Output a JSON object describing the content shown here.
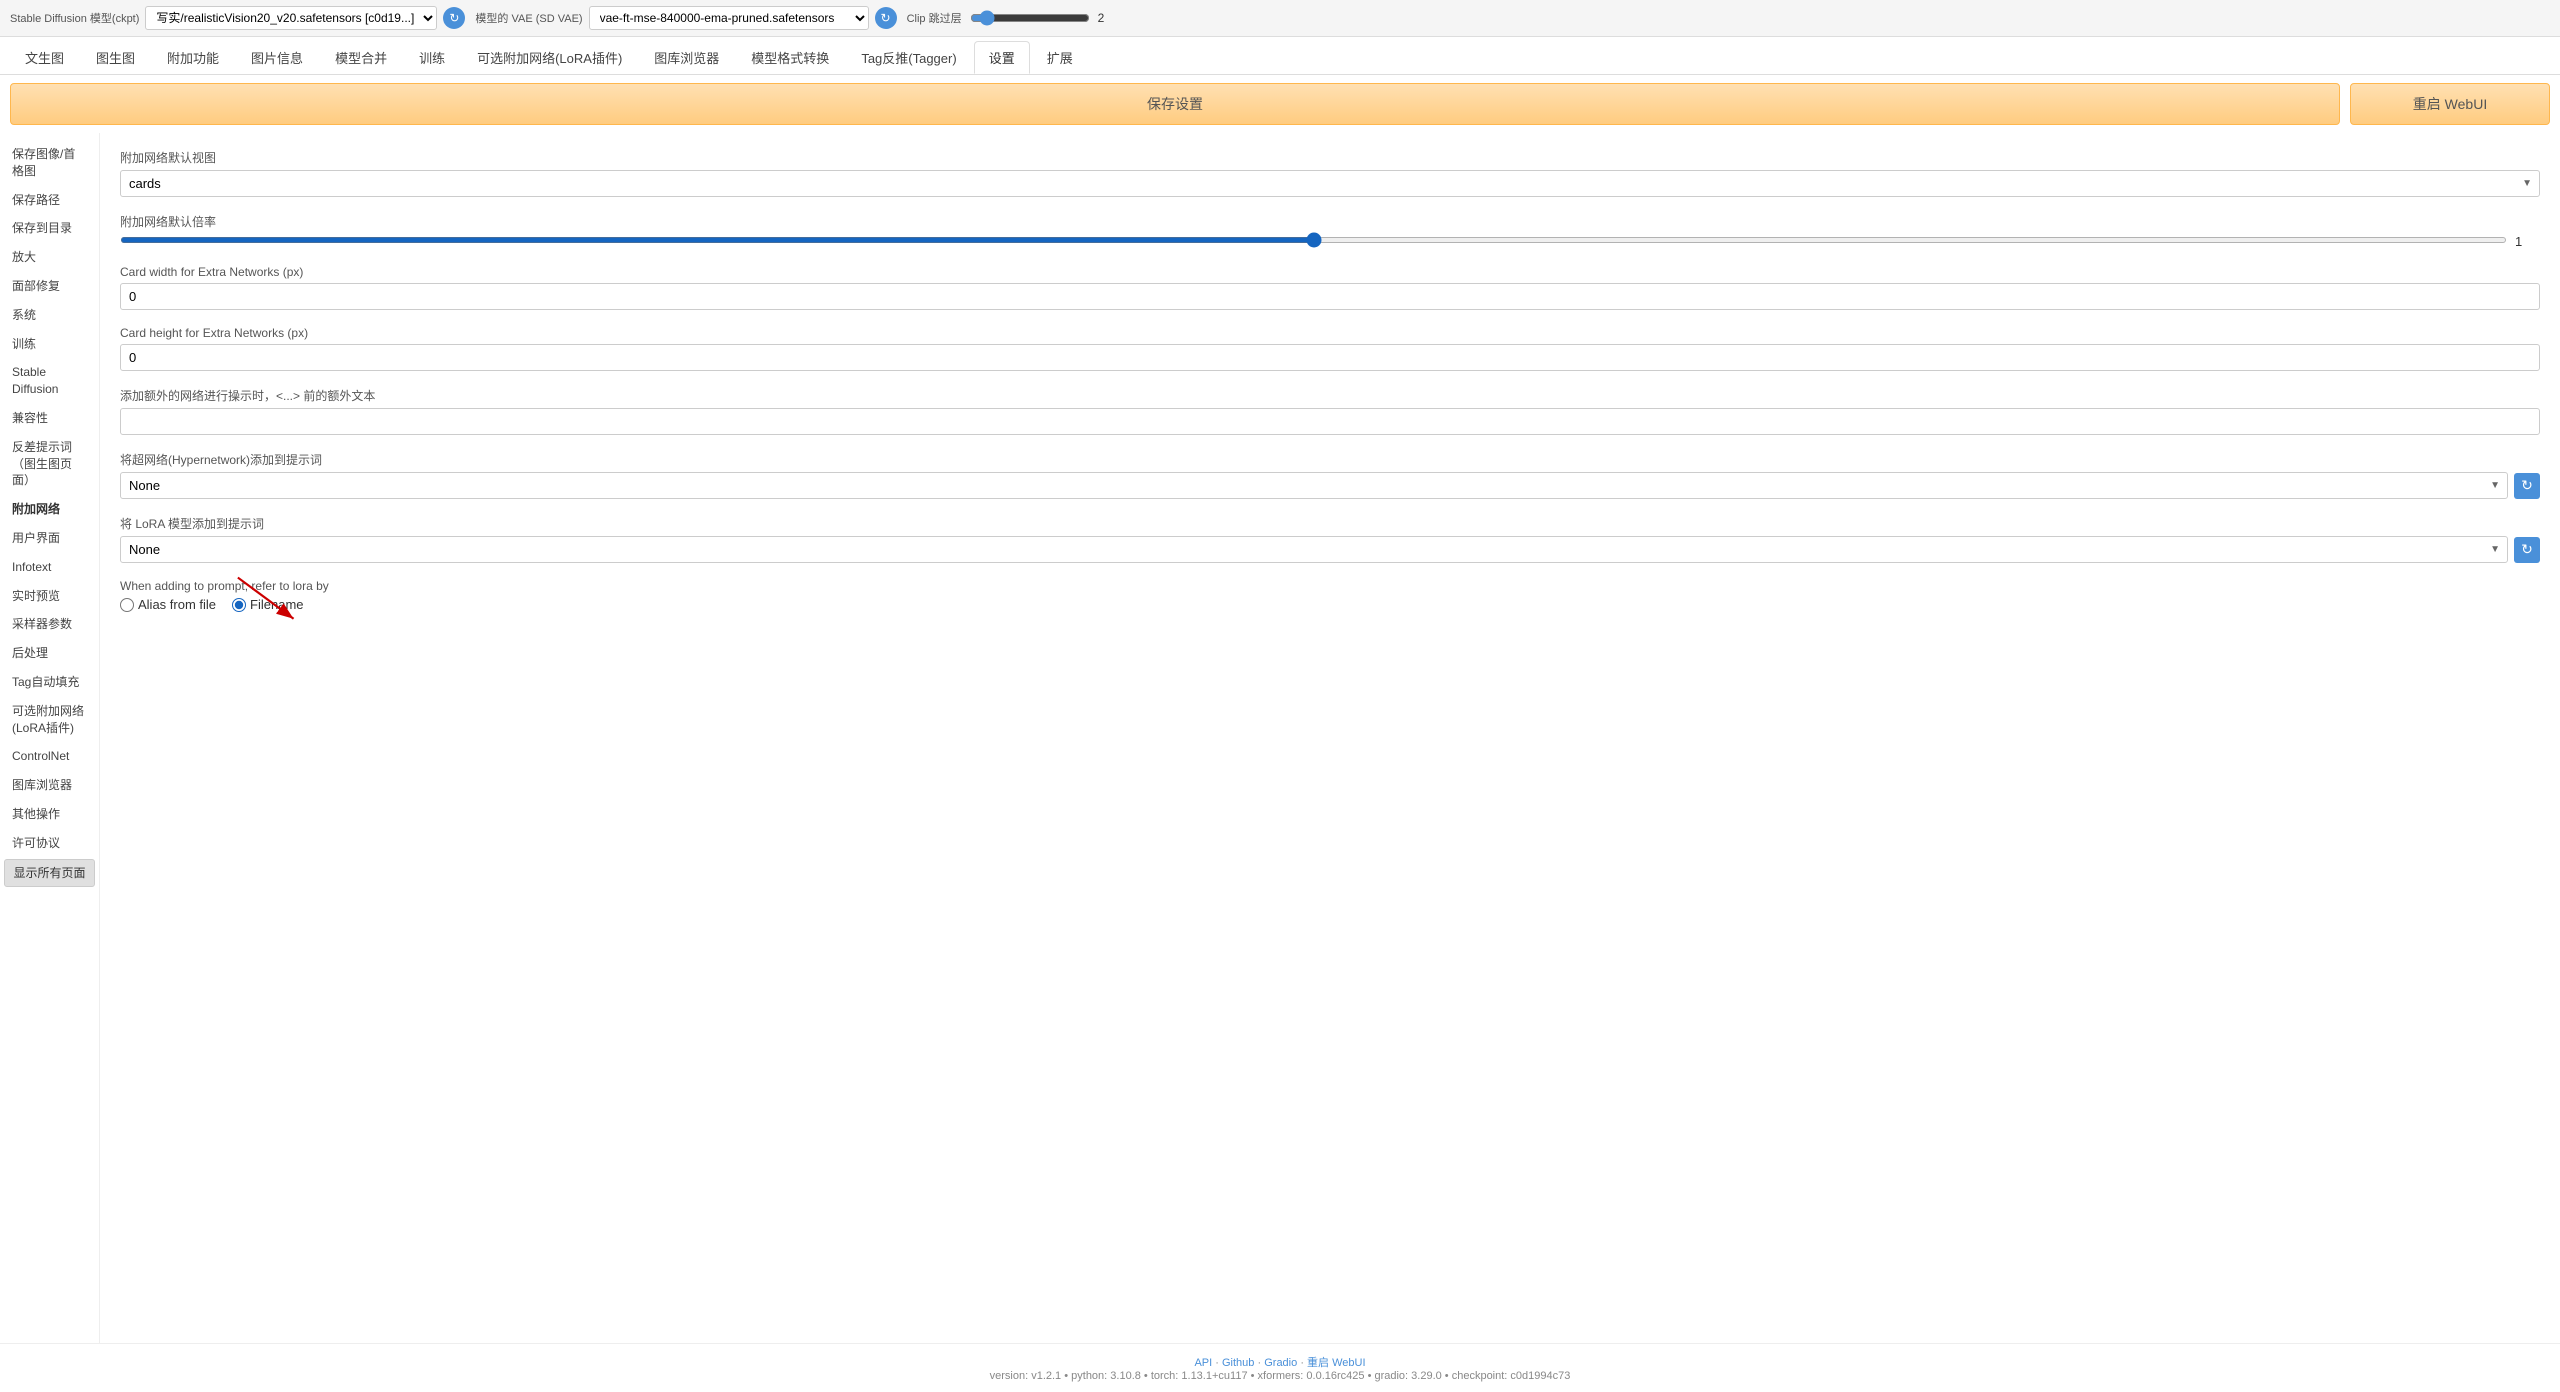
{
  "topbar": {
    "sd_model_label": "Stable Diffusion 模型(ckpt)",
    "sd_model_value": "写实/realisticVision20_v20.safetensors [c0d19...]",
    "vae_label": "模型的 VAE (SD VAE)",
    "vae_value": "vae-ft-mse-840000-ema-pruned.safetensors",
    "clip_label": "Clip 跳过层",
    "clip_value": "2"
  },
  "navtabs": {
    "items": [
      {
        "label": "文生图",
        "active": false
      },
      {
        "label": "图生图",
        "active": false
      },
      {
        "label": "附加功能",
        "active": false
      },
      {
        "label": "图片信息",
        "active": false
      },
      {
        "label": "模型合并",
        "active": false
      },
      {
        "label": "训练",
        "active": false
      },
      {
        "label": "可选附加网络(LoRA插件)",
        "active": false
      },
      {
        "label": "图库浏览器",
        "active": false
      },
      {
        "label": "模型格式转换",
        "active": false
      },
      {
        "label": "Tag反推(Tagger)",
        "active": false
      },
      {
        "label": "设置",
        "active": true
      },
      {
        "label": "扩展",
        "active": false
      }
    ]
  },
  "actionbar": {
    "save_btn": "保存设置",
    "restart_btn": "重启 WebUI"
  },
  "sidebar": {
    "items": [
      {
        "label": "保存图像/首格图",
        "active": false
      },
      {
        "label": "保存路径",
        "active": false
      },
      {
        "label": "保存到目录",
        "active": false
      },
      {
        "label": "放大",
        "active": false
      },
      {
        "label": "面部修复",
        "active": false
      },
      {
        "label": "系统",
        "active": false
      },
      {
        "label": "训练",
        "active": false
      },
      {
        "label": "Stable Diffusion",
        "active": false
      },
      {
        "label": "兼容性",
        "active": false
      },
      {
        "label": "反差提示词（图生图页面）",
        "active": false
      },
      {
        "label": "附加网络",
        "active": true
      },
      {
        "label": "用户界面",
        "active": false
      },
      {
        "label": "Infotext",
        "active": false
      },
      {
        "label": "实时预览",
        "active": false
      },
      {
        "label": "采样器参数",
        "active": false
      },
      {
        "label": "后处理",
        "active": false
      },
      {
        "label": "Tag自动填充",
        "active": false
      },
      {
        "label": "可选附加网络(LoRA插件)",
        "active": false
      },
      {
        "label": "ControlNet",
        "active": false
      },
      {
        "label": "图库浏览器",
        "active": false
      },
      {
        "label": "其他操作",
        "active": false
      },
      {
        "label": "许可协议",
        "active": false
      },
      {
        "label": "显示所有页面",
        "active": false,
        "is_button": true
      }
    ]
  },
  "settings": {
    "section_title": "附加网络默认视图",
    "default_view_label": "附加网络默认视图",
    "default_view_value": "cards",
    "default_multiplier_label": "附加网络默认倍率",
    "default_multiplier_value": "1",
    "card_width_label": "Card width for Extra Networks (px)",
    "card_width_value": "0",
    "card_height_label": "Card height for Extra Networks (px)",
    "card_height_value": "0",
    "extra_text_label": "添加额外的网络进行操示时，<...> 前的额外文本",
    "extra_text_value": "",
    "hypernetwork_label": "将超网络(Hypernetwork)添加到提示词",
    "hypernetwork_value": "None",
    "lora_label": "将 LoRA 模型添加到提示词",
    "lora_value": "None",
    "refer_by_label": "When adding to prompt, refer to lora by",
    "alias_from_file_label": "Alias from file",
    "filename_label": "Filename",
    "selected_radio": "filename"
  },
  "footer": {
    "api_link": "API",
    "github_link": "Github",
    "gradio_link": "Gradio",
    "restart_link": "重启 WebUI",
    "version_info": "version: v1.2.1  •  python: 3.10.8  •  torch: 1.13.1+cu117  •  xformers: 0.0.16rc425  •  gradio: 3.29.0  •  checkpoint: c0d1994c73"
  }
}
